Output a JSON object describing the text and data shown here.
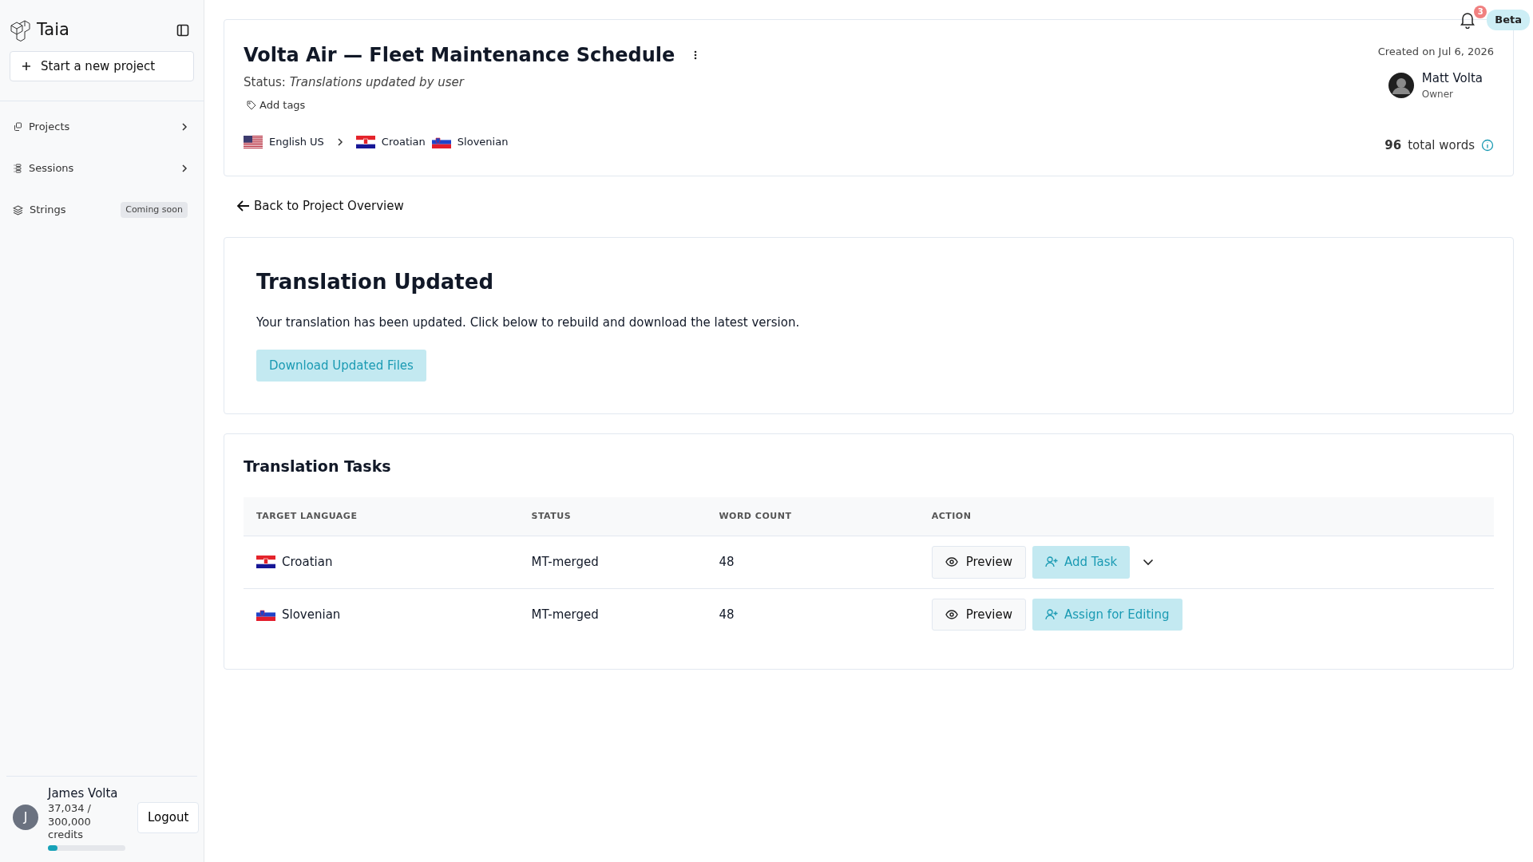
{
  "sidebar": {
    "brand": "Taia",
    "new_project": "Start a new project",
    "items": [
      {
        "label": "Projects",
        "kind": "expand"
      },
      {
        "label": "Sessions",
        "kind": "expand"
      },
      {
        "label": "Strings",
        "kind": "soon",
        "badge": "Coming soon"
      }
    ],
    "user": {
      "initial": "J",
      "name": "James Volta",
      "credits": "37,034 / 300,000 credits",
      "level": 0.123
    },
    "logout": "Logout"
  },
  "topbar": {
    "notifications": "3",
    "beta": "Beta"
  },
  "project": {
    "title": "Volta Air — Fleet Maintenance Schedule",
    "status_label": "Status:",
    "status": "Translations updated by user",
    "add_tags": "Add tags",
    "source": {
      "label": "English US"
    },
    "targets": [
      {
        "label": "Croatian"
      },
      {
        "label": "Slovenian"
      }
    ],
    "created": "Created on Jul 6, 2026",
    "owner": {
      "name": "Matt Volta",
      "role": "Owner"
    },
    "total_count": "96",
    "total_label": "total words"
  },
  "back_link": "Back to Project Overview",
  "update_card": {
    "title": "Translation Updated",
    "message": "Your translation has been updated. Click below to rebuild and download the latest version.",
    "button": "Download Updated Files"
  },
  "tasks": {
    "title": "Translation Tasks",
    "columns": [
      "TARGET LANGUAGE",
      "STATUS",
      "WORD COUNT",
      "ACTION"
    ],
    "rows": [
      {
        "language": "Croatian",
        "status": "MT-merged",
        "word_count": "48",
        "actions": [
          {
            "label": "Preview",
            "kind": "preview"
          },
          {
            "label": "Add Task",
            "kind": "assign"
          }
        ],
        "menu": true
      },
      {
        "language": "Slovenian",
        "status": "MT-merged",
        "word_count": "48",
        "actions": [
          {
            "label": "Preview",
            "kind": "preview"
          },
          {
            "label": "Assign for Editing",
            "kind": "assign"
          }
        ],
        "menu": false
      }
    ]
  }
}
